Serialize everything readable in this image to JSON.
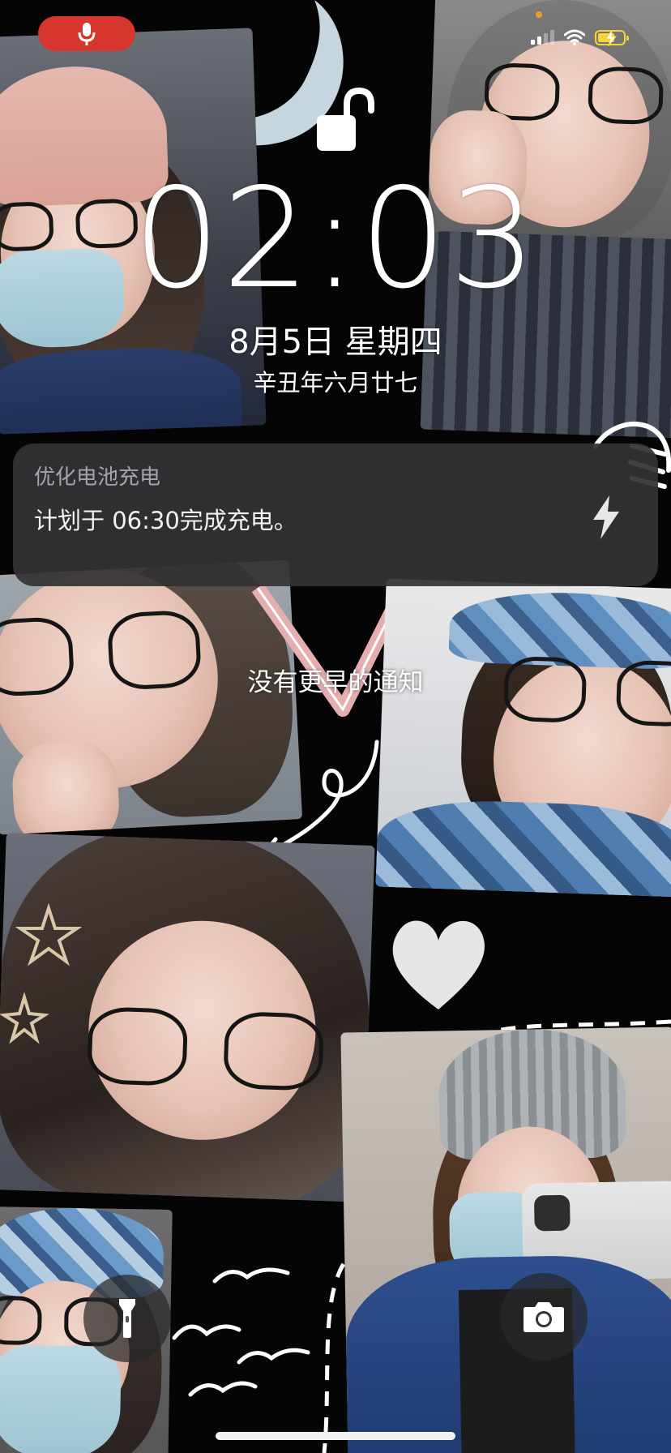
{
  "status_bar": {
    "mic_icon": "microphone-icon",
    "signal_icon": "cellular-signal-icon",
    "wifi_icon": "wifi-icon",
    "battery_icon": "battery-charging-icon",
    "battery_color": "#f5d33a",
    "battery_level": 0.6,
    "mic_pill_color": "#d7362f"
  },
  "lock": {
    "icon": "unlocked-padlock-icon",
    "time": "02:03",
    "date": "8月5日 星期四",
    "lunar_date": "辛丑年六月廿七"
  },
  "notification": {
    "app_name": "优化电池充电",
    "message": "计划于 06:30完成充电。",
    "icon": "lightning-bolt-icon"
  },
  "no_earlier_notifications": "没有更早的通知",
  "controls": {
    "flashlight_icon": "flashlight-icon",
    "camera_icon": "camera-icon"
  }
}
